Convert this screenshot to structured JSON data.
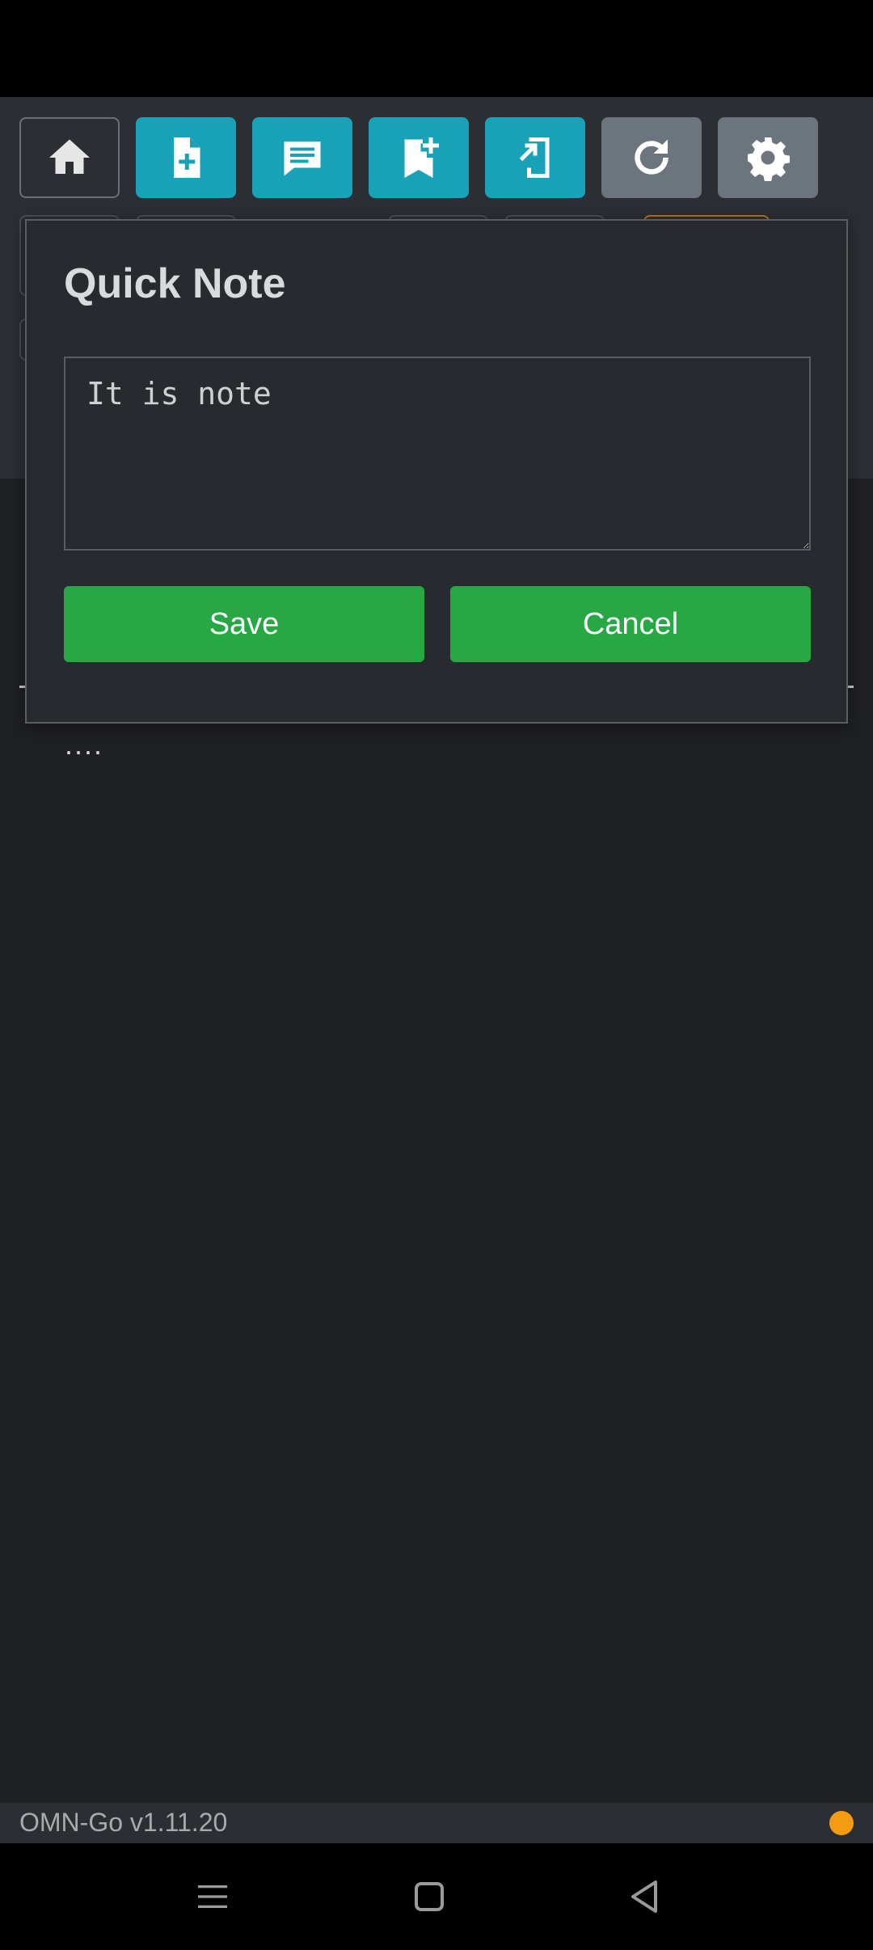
{
  "toolbar": {
    "buttons": [
      {
        "name": "home-button",
        "icon": "home-icon",
        "color": "#2b2e33"
      },
      {
        "name": "new-document-button",
        "icon": "file-plus-icon",
        "color": "#17a2b8"
      },
      {
        "name": "comment-button",
        "icon": "comment-icon",
        "color": "#17a2b8"
      },
      {
        "name": "add-bookmark-button",
        "icon": "bookmark-plus-icon",
        "color": "#17a2b8"
      },
      {
        "name": "send-to-device-button",
        "icon": "device-export-icon",
        "color": "#17a2b8"
      },
      {
        "name": "refresh-button",
        "icon": "refresh-icon",
        "color": "#6c757d"
      },
      {
        "name": "settings-button",
        "icon": "gear-icon",
        "color": "#6c757d"
      }
    ]
  },
  "background": {
    "dots": "...."
  },
  "modal": {
    "title": "Quick Note",
    "note_value": "It is note",
    "save_label": "Save",
    "cancel_label": "Cancel"
  },
  "footer": {
    "version": "OMN-Go v1.11.20",
    "status_color": "#f39c12"
  },
  "navbar": {
    "items": [
      "menu-icon",
      "home-square-icon",
      "back-icon"
    ]
  }
}
